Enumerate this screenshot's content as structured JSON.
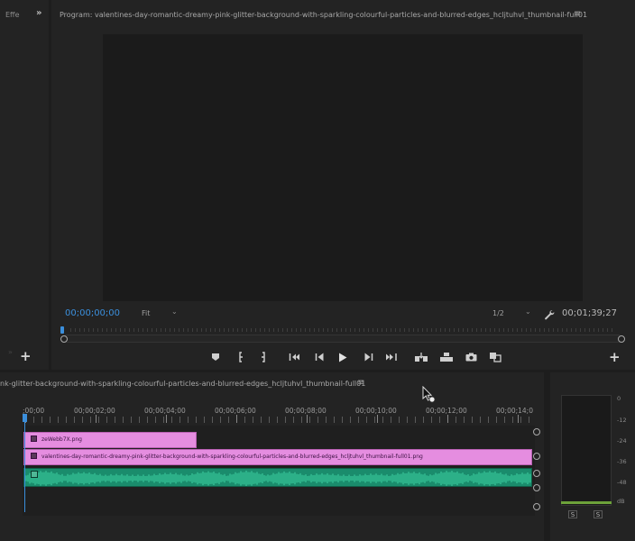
{
  "left_panel": {
    "tab_label": "Effe",
    "more_glyph": "»",
    "faint_glyph": "»",
    "add_glyph": "+"
  },
  "program": {
    "title": "Program: valentines-day-romantic-dreamy-pink-glitter-background-with-sparkling-colourful-particles-and-blurred-edges_hcljtuhvl_thumbnail-full01",
    "menu_glyph": "≡",
    "timecode_current": "00;00;00;00",
    "fit_label": "Fit",
    "resolution_label": "1/2",
    "caret_glyph": "⌄",
    "timecode_duration": "00;01;39;27",
    "add_glyph": "+",
    "controls": [
      "marker-icon",
      "mark-in-icon",
      "mark-out-icon",
      "go-to-in-icon",
      "step-back-icon",
      "play-icon",
      "step-forward-icon",
      "go-to-out-icon",
      "insert-icon",
      "overwrite-icon",
      "export-frame-icon",
      "comparison-view-icon"
    ]
  },
  "timeline": {
    "title": "nk-glitter-background-with-sparkling-colourful-particles-and-blurred-edges_hcljtuhvl_thumbnail-full01",
    "menu_glyph": "≡",
    "ruler_labels": [
      ";00;00",
      "00;00;02;00",
      "00;00;04;00",
      "00;00;06;00",
      "00;00;08;00",
      "00;00;10;00",
      "00;00;12;00",
      "00;00;14;0"
    ],
    "clips": {
      "v2": "zeWebb7X.png",
      "v1": "valentines-day-romantic-dreamy-pink-glitter-background-with-sparkling-colourful-particles-and-blurred-edges_hcljtuhvl_thumbnail-full01.png"
    }
  },
  "meter": {
    "db_labels": [
      "0",
      "-12",
      "-24",
      "-36",
      "-48",
      "dB"
    ],
    "solo_labels": [
      "S",
      "S"
    ],
    "level_color": "#6da23a"
  },
  "colors": {
    "accent": "#3b8fdc",
    "video_clip": "#e58de0",
    "audio_clip": "#1a8c6c"
  }
}
